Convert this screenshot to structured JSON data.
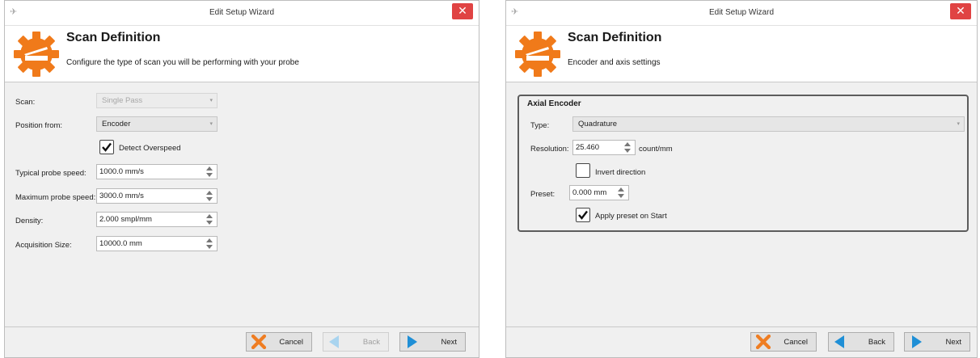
{
  "left": {
    "window_title": "Edit Setup Wizard",
    "header_title": "Scan Definition",
    "header_subtitle": "Configure the type of scan you will be performing with your probe",
    "scan_label": "Scan:",
    "scan_value": "Single Pass",
    "position_label": "Position from:",
    "position_value": "Encoder",
    "detect_label": "Detect Overspeed",
    "typical_label": "Typical probe speed:",
    "typical_value": "1000.0 mm/s",
    "maximum_label": "Maximum probe speed:",
    "maximum_value": "3000.0 mm/s",
    "density_label": "Density:",
    "density_value": "2.000 smpl/mm",
    "acq_label": "Acquisition Size:",
    "acq_value": "10000.0 mm",
    "cancel": "Cancel",
    "back": "Back",
    "next": "Next"
  },
  "right": {
    "window_title": "Edit Setup Wizard",
    "header_title": "Scan Definition",
    "header_subtitle": "Encoder and axis settings",
    "group_title": "Axial Encoder",
    "type_label": "Type:",
    "type_value": "Quadrature",
    "resolution_label": "Resolution:",
    "resolution_value": "25.460",
    "resolution_unit": "count/mm",
    "invert_label": "Invert direction",
    "preset_label": "Preset:",
    "preset_value": "0.000 mm",
    "apply_label": "Apply preset on Start",
    "cancel": "Cancel",
    "back": "Back",
    "next": "Next"
  },
  "colors": {
    "accent_orange": "#f07a1a",
    "cancel_orange": "#ef7d22",
    "nav_blue": "#1f8fd6",
    "close_red": "#e04343"
  },
  "icons": {
    "gear": "gear-icon",
    "close": "close-icon",
    "cancel": "x-icon",
    "back": "left-arrow-icon",
    "next": "right-arrow-icon"
  }
}
